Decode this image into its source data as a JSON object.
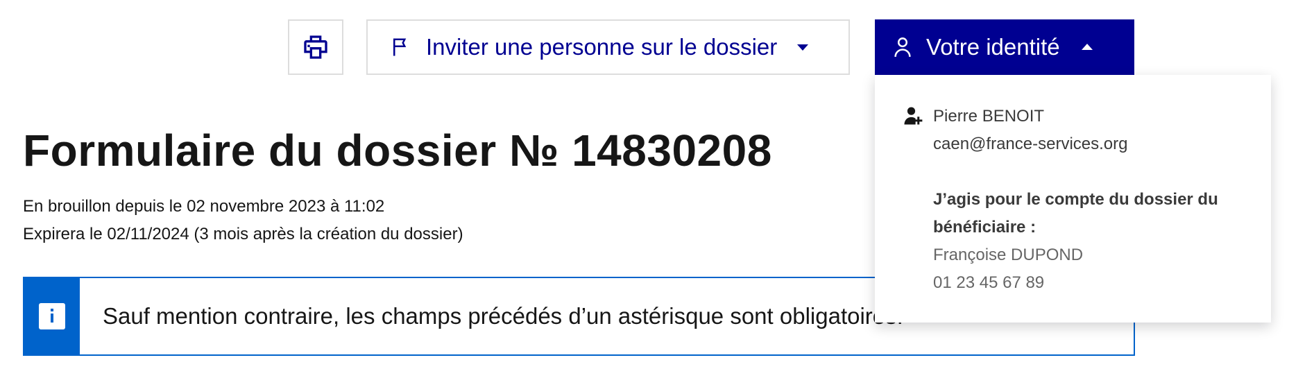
{
  "toolbar": {
    "print_label": "",
    "invite_label": "Inviter une personne sur le dossier",
    "identity_label": "Votre identité"
  },
  "header": {
    "title": "Formulaire du dossier № 14830208",
    "status_line": "En brouillon depuis le 02 novembre 2023 à 11:02",
    "expiry_line": "Expirera le 02/11/2024 (3 mois après la création du dossier)"
  },
  "notice": {
    "text": "Sauf mention contraire, les champs précédés d’un astérisque sont obligatoires."
  },
  "identity_menu": {
    "user_name": "Pierre BENOIT",
    "user_email": "caen@france-services.org",
    "acting_label": "J’agis pour le compte du dossier du bénéficiaire :",
    "beneficiary_name": "Françoise DUPOND",
    "beneficiary_phone": "01 23 45 67 89"
  },
  "colors": {
    "primary": "#000091",
    "info": "#0063cb",
    "border": "#dddddd"
  },
  "icons": {
    "print": "printer-icon",
    "invite": "flag-icon",
    "identity": "user-icon",
    "caret_down": "caret-down-icon",
    "caret_up": "caret-up-icon",
    "info": "info-icon",
    "person_add": "person-add-icon"
  }
}
